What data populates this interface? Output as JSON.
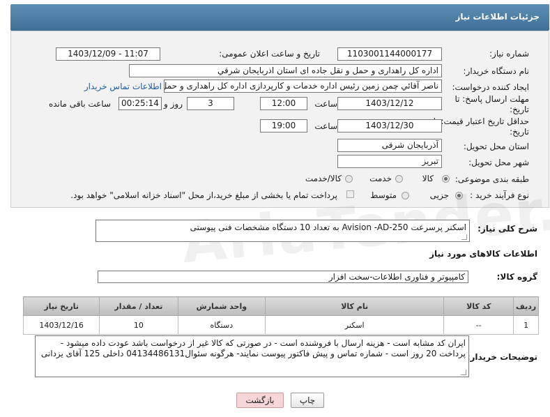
{
  "header": {
    "title": "جزئیات اطلاعات نیاز"
  },
  "form": {
    "need_number_label": "شماره نیاز:",
    "need_number": "1103001144000177",
    "announce_label": "تاریخ و ساعت اعلان عمومی:",
    "announce_value": "1403/12/09 - 11:07",
    "buyer_label": "نام دستگاه خریدار:",
    "buyer_value": "اداره کل راهداری و حمل و نقل جاده ای استان اذربایجان شرقي",
    "creator_label": "ایجاد کننده درخواست:",
    "creator_value": "ناصر آقائي چمن زمين رئيس اداره خدمات و کارپردازی اداره کل راهداری و حمل و",
    "contact_link": "اطلاعات تماس خریدار",
    "deadline_label": "مهلت ارسال پاسخ: تا تاریخ:",
    "deadline_date": "1403/12/12",
    "time_label": "ساعت",
    "deadline_time": "12:00",
    "days_value": "3",
    "days_label": "روز و",
    "remaining_value": "00:25:14",
    "remaining_label": "ساعت باقی مانده",
    "validity_label": "حداقل تاریخ اعتبار قیمت: تا تاریخ:",
    "validity_date": "1403/12/30",
    "validity_time": "19:00",
    "province_label": "استان محل تحویل:",
    "province_value": "آذربایجان شرقی",
    "city_label": "شهر محل تحویل:",
    "city_value": "تبریز",
    "category_label": "طبقه بندی موضوعی:",
    "category_options": [
      "کالا",
      "خدمت",
      "کالا/خدمت"
    ],
    "process_label": "نوع فرآیند خرید :",
    "process_options": [
      "جزیی",
      "متوسط"
    ],
    "payment_note": "پرداخت تمام یا بخشی از مبلغ خرید،از محل \"اسناد خزانه اسلامی\" خواهد بود."
  },
  "summary": {
    "label": "شرح کلی نیاز:",
    "value": "اسکنر پرسرعت Avision -AD-250 به تعداد 10 دستگاه  مشخصات فنی پیوستی"
  },
  "goods": {
    "section_title": "اطلاعات کالاهای مورد نیاز",
    "group_label": "گروه کالا:",
    "group_value": "کامپیوتر و فناوری اطلاعات-سخت افزار",
    "columns": [
      "ردیف",
      "کد کالا",
      "نام کالا",
      "واحد شمارش",
      "تعداد / مقدار",
      "تاریخ نیاز"
    ],
    "rows": [
      {
        "row": "1",
        "code": "--",
        "name": "اسکنر",
        "unit": "دستگاه",
        "qty": "10",
        "date": "1403/12/16"
      }
    ]
  },
  "buyer_notes": {
    "label": "توضیحات خریدار:",
    "value": "ایران کد مشابه است - هزینه ارسال با فروشنده است - در صورتی که کالا غیر از درخواست باشد عودت داده میشود - پرداخت 20 روز است - شماره تماس و پیش فاکتور پیوست نمایند-  هرگونه سئوال04134486131 داخلی 125 آقای یزدانی"
  },
  "buttons": {
    "print": "چاپ",
    "back": "بازگشت"
  },
  "watermark": "AriaTender.neT",
  "colors": {
    "header": "#4a7ca3",
    "link": "#1f5aa6",
    "back_button": "#f6d6d6"
  }
}
